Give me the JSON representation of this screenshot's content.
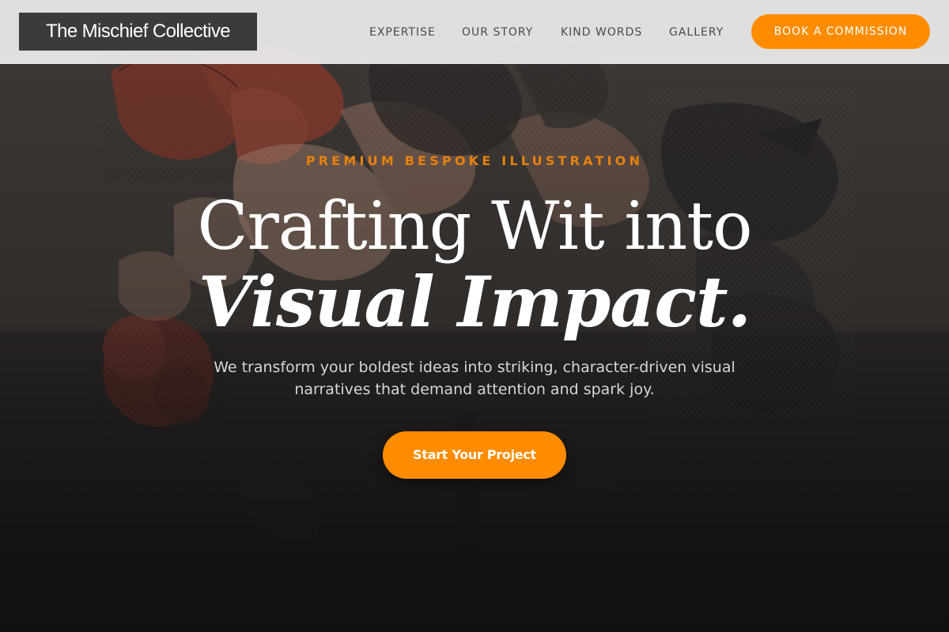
{
  "header": {
    "logo_text": "The Mischief Collective",
    "nav": [
      {
        "label": "EXPERTISE"
      },
      {
        "label": "OUR STORY"
      },
      {
        "label": "KIND WORDS"
      },
      {
        "label": "GALLERY"
      }
    ],
    "cta_label": "BOOK A COMMISSION"
  },
  "hero": {
    "eyebrow": "PREMIUM BESPOKE ILLUSTRATION",
    "headline_line1": "Crafting Wit into",
    "headline_line2": "Visual Impact.",
    "subtitle": "We transform your boldest ideas into striking, character-driven visual narratives that demand attention and spark joy.",
    "cta_label": "Start Your Project",
    "background_icon": "floral-engraving-illustration"
  },
  "colors": {
    "accent": "#ff8c00",
    "eyebrow": "#e5820f",
    "logo_bg": "#3b3b3b",
    "header_bg": "#ececec",
    "nav_text": "#454a52",
    "hero_dark": "#1c1c1c"
  }
}
